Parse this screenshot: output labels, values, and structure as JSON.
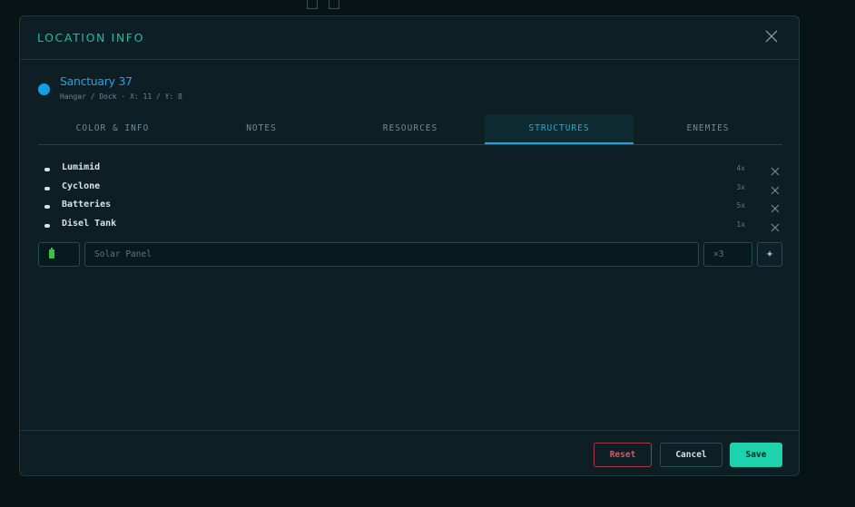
{
  "modal": {
    "title": "LOCATION INFO"
  },
  "location": {
    "name": "Sanctuary 37",
    "meta": "Hangar / Dock  ·  X: 11 / Y: 8",
    "color": "#14a0e6"
  },
  "tabs": [
    {
      "label": "COLOR & INFO",
      "active": false
    },
    {
      "label": "NOTES",
      "active": false
    },
    {
      "label": "RESOURCES",
      "active": false
    },
    {
      "label": "STRUCTURES",
      "active": true
    },
    {
      "label": "ENEMIES",
      "active": false
    }
  ],
  "structures": [
    {
      "name": "Lumimid",
      "qty": "4x"
    },
    {
      "name": "Cyclone",
      "qty": "3x"
    },
    {
      "name": "Batteries",
      "qty": "5x"
    },
    {
      "name": "Disel Tank",
      "qty": "1x"
    }
  ],
  "add_form": {
    "icon": "battery-icon",
    "name_placeholder": "Solar Panel",
    "qty_placeholder": "×3",
    "add_label": "+"
  },
  "footer": {
    "reset_label": "Reset",
    "cancel_label": "Cancel",
    "save_label": "Save"
  },
  "colors": {
    "accent": "#18c1a2",
    "tab_active": "#1ca6df",
    "danger": "#d65665",
    "save": "#1dd2ad"
  }
}
